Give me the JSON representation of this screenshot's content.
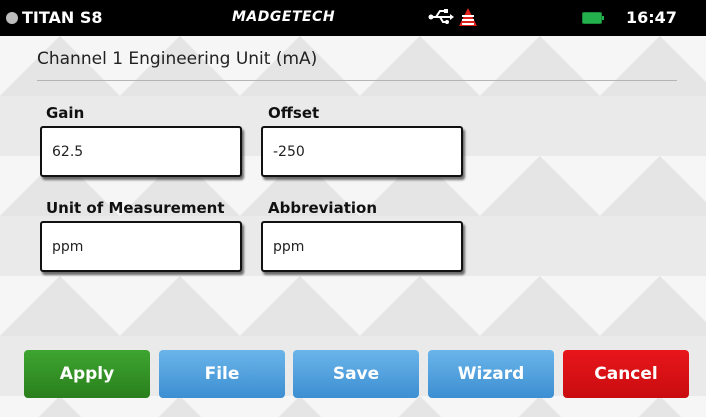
{
  "status_bar": {
    "device_name": "TITAN S8",
    "brand": "MADGETECH",
    "time": "16:47",
    "icons": [
      "usb-icon",
      "alert-icon",
      "battery-icon"
    ],
    "battery_color": "#22b14c",
    "alert_color": "#e0201b"
  },
  "page": {
    "title": "Channel 1 Engineering Unit (mA)"
  },
  "form": {
    "gain": {
      "label": "Gain",
      "value": "62.5"
    },
    "offset": {
      "label": "Offset",
      "value": "-250"
    },
    "unit": {
      "label": "Unit of Measurement",
      "value": "ppm"
    },
    "abbreviation": {
      "label": "Abbreviation",
      "value": "ppm"
    }
  },
  "buttons": {
    "apply": "Apply",
    "file": "File",
    "save": "Save",
    "wizard": "Wizard",
    "cancel": "Cancel"
  },
  "colors": {
    "apply": "#3da530",
    "blue_buttons": "#4f9fde",
    "cancel": "#d81014"
  }
}
